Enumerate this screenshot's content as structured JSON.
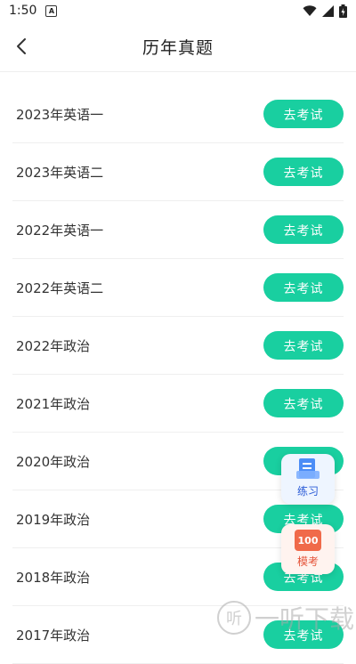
{
  "status_bar": {
    "time": "1:50",
    "badge": "A"
  },
  "header": {
    "title": "历年真题"
  },
  "items": [
    {
      "label": "2023年英语一",
      "button": "去考试"
    },
    {
      "label": "2023年英语二",
      "button": "去考试"
    },
    {
      "label": "2022年英语一",
      "button": "去考试"
    },
    {
      "label": "2022年英语二",
      "button": "去考试"
    },
    {
      "label": "2022年政治",
      "button": "去考试"
    },
    {
      "label": "2021年政治",
      "button": "去考试"
    },
    {
      "label": "2020年政治",
      "button": "去考试"
    },
    {
      "label": "2019年政治",
      "button": "去考试"
    },
    {
      "label": "2018年政治",
      "button": "去考试"
    },
    {
      "label": "2017年政治",
      "button": "去考试"
    }
  ],
  "floating": {
    "practice_label": "练习",
    "mock_label": "模考",
    "mock_icon_text": "100"
  },
  "watermark": {
    "icon_text": "听",
    "text": "一听下载"
  },
  "colors": {
    "accent": "#19cfa0",
    "practice_text": "#2a5bd7",
    "mock_text": "#e5553b"
  }
}
